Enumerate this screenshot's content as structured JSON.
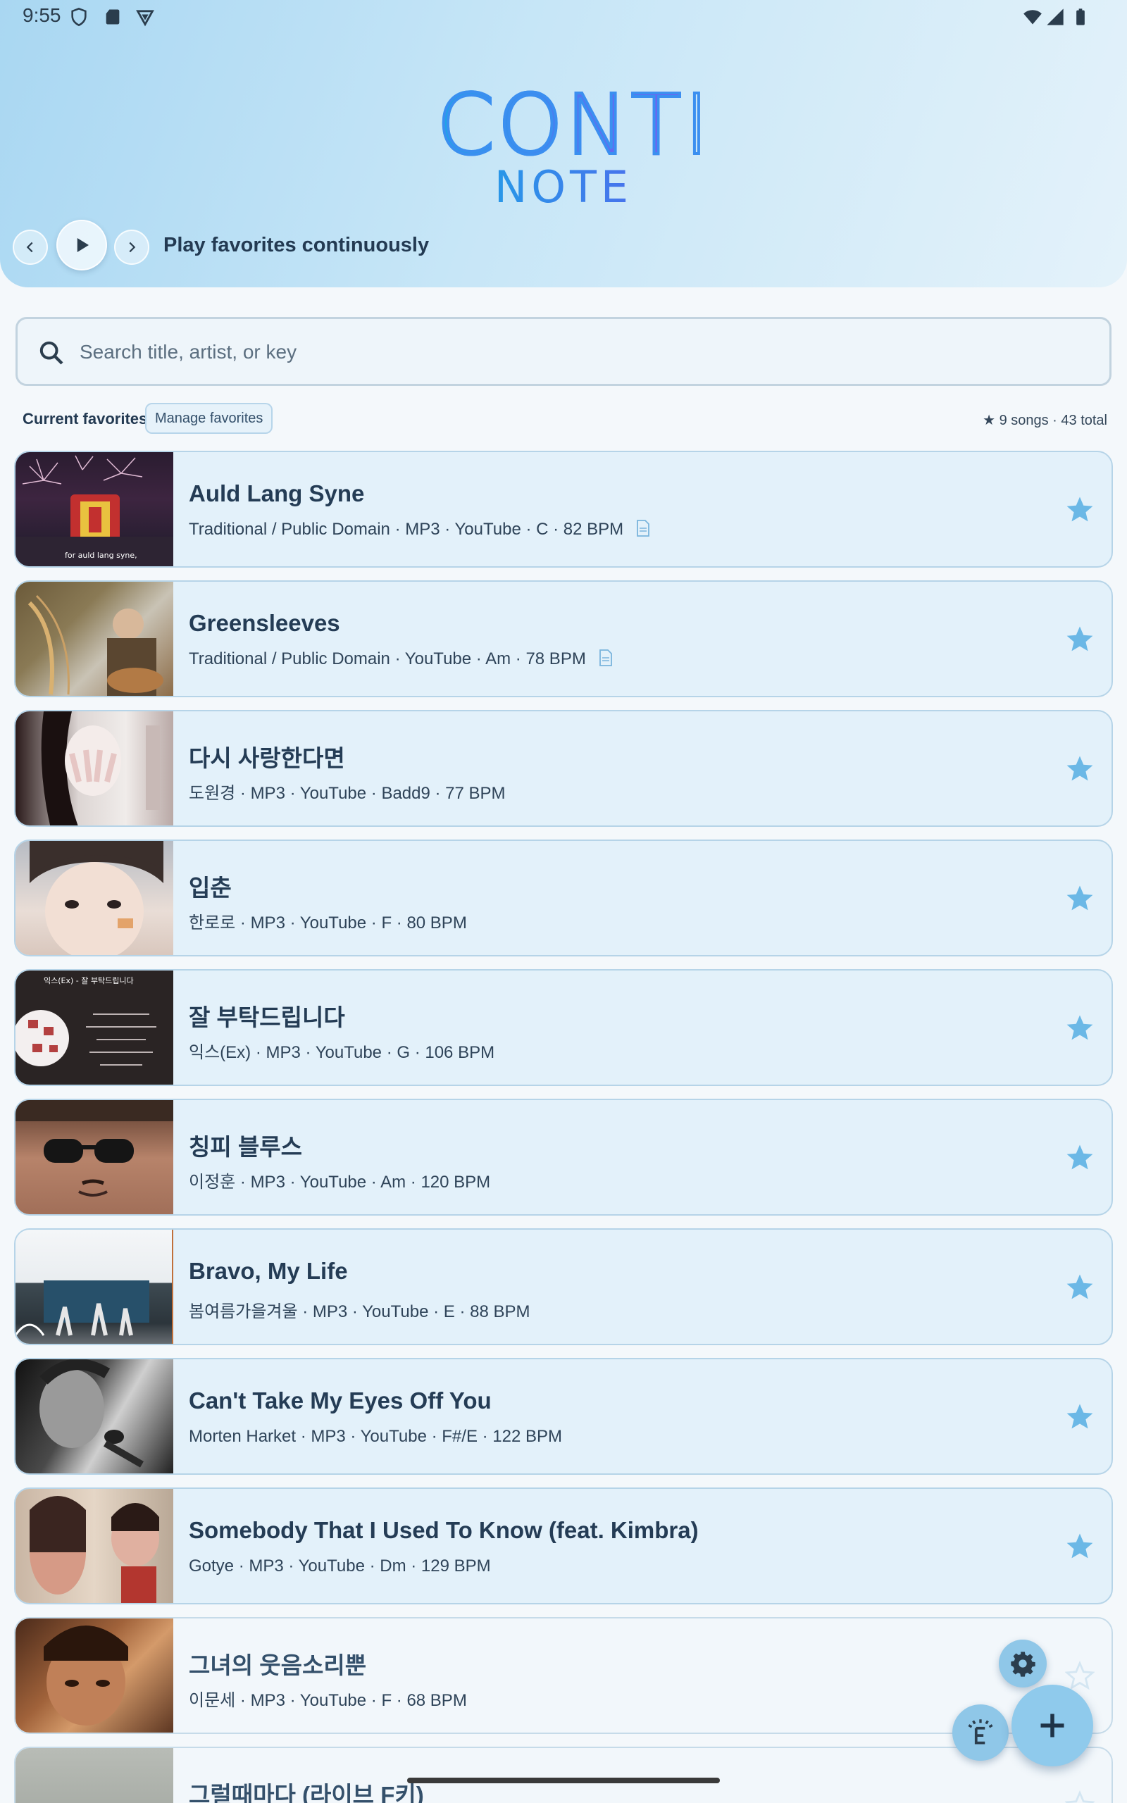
{
  "status_bar": {
    "time": "9:55"
  },
  "app": {
    "logo_top": "CONTI",
    "logo_bottom": "NOTE"
  },
  "player": {
    "label": "Play favorites continuously"
  },
  "search": {
    "placeholder": "Search title, artist, or key",
    "value": ""
  },
  "favorites": {
    "title": "Current favorites",
    "manage_label": "Manage favorites",
    "count_text": "★ 9 songs · 43 total"
  },
  "songs": [
    {
      "title": "Auld Lang Syne",
      "meta": "Traditional / Public Domain · MP3 · YouTube · C · 82 BPM",
      "has_doc": true,
      "favorite": true
    },
    {
      "title": "Greensleeves",
      "meta": "Traditional / Public Domain · YouTube · Am · 78 BPM",
      "has_doc": true,
      "favorite": true
    },
    {
      "title": "다시 사랑한다면",
      "meta": "도원경 · MP3 · YouTube · Badd9 · 77 BPM",
      "has_doc": false,
      "favorite": true
    },
    {
      "title": "입춘",
      "meta": "한로로 · MP3 · YouTube · F · 80 BPM",
      "has_doc": false,
      "favorite": true
    },
    {
      "title": "잘 부탁드립니다",
      "meta": "익스(Ex) · MP3 · YouTube · G · 106 BPM",
      "has_doc": false,
      "favorite": true
    },
    {
      "title": "칭피 블루스",
      "meta": "이정훈 · MP3 · YouTube · Am · 120 BPM",
      "has_doc": false,
      "favorite": true
    },
    {
      "title": "Bravo, My Life",
      "meta": "봄여름가을겨울 · MP3 · YouTube · E · 88 BPM",
      "has_doc": false,
      "favorite": true
    },
    {
      "title": "Can't Take My Eyes Off You",
      "meta": "Morten Harket · MP3 · YouTube · F#/E · 122 BPM",
      "has_doc": false,
      "favorite": true
    },
    {
      "title": "Somebody That I Used To Know (feat. Kimbra)",
      "meta": "Gotye · MP3 · YouTube · Dm · 129 BPM",
      "has_doc": false,
      "favorite": true
    },
    {
      "title": "그녀의 웃음소리뿐",
      "meta": "이문세 · MP3 · YouTube · F · 68 BPM",
      "has_doc": false,
      "favorite": false
    },
    {
      "title": "그럴때마다 (라이브 F키)",
      "meta": "",
      "has_doc": false,
      "favorite": false
    }
  ],
  "thumb_text": {
    "auld": "for auld lang syne,",
    "ex": "익스(Ex) - 잘 부탁드립니다"
  },
  "colors": {
    "accent": "#8fcaec",
    "star_fav": "#6bb8e6",
    "star_empty": "#d4e6f2"
  }
}
